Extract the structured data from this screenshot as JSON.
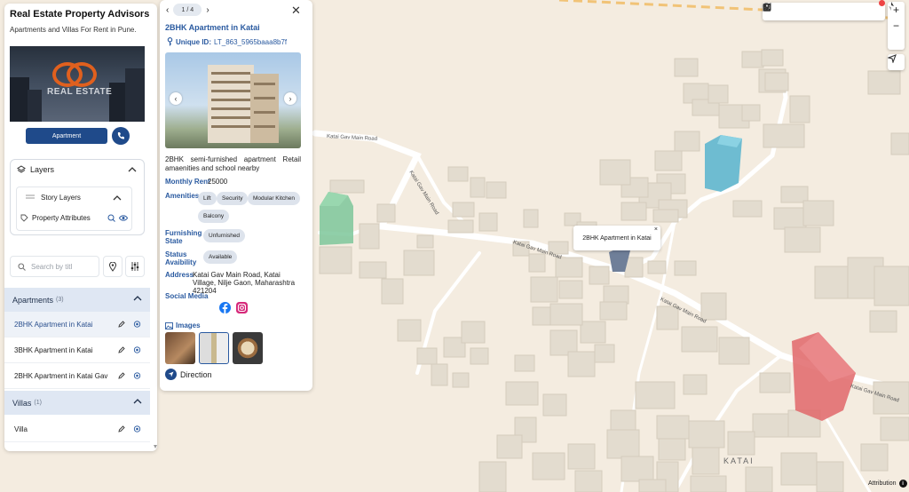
{
  "sidebar": {
    "title": "Real Estate Property Advisors",
    "subtitle": "Apartments and Villas For Rent in Pune.",
    "logo_text": "REAL ESTATE",
    "apartment_button": "Apartment",
    "layers": {
      "heading": "Layers",
      "story_layers": "Story Layers",
      "property_attributes": "Property Attributes"
    },
    "search": {
      "placeholder": "Search by titl"
    },
    "groups": [
      {
        "label": "Apartments",
        "count": "(3)",
        "items": [
          {
            "label": "2BHK Apartment in Katai",
            "active": true
          },
          {
            "label": "3BHK Apartment in Katai",
            "active": false
          },
          {
            "label": "2BHK Apartment in Katai Gav",
            "active": false
          }
        ]
      },
      {
        "label": "Villas",
        "count": "(1)",
        "items": [
          {
            "label": "Villa",
            "active": false
          }
        ]
      }
    ]
  },
  "detail": {
    "pager": "1 / 4",
    "title": "2BHK Apartment in Katai",
    "unique_id_label": "Unique ID:",
    "unique_id_value": "LT_863_5965baaa8b7f",
    "description": "2BHK semi-furnished apartment Retail amaenities and school nearby",
    "monthly_rent_label": "Monthly Rent",
    "monthly_rent_value": "25000",
    "amenities_label": "Amenities",
    "amenities": [
      "Lift",
      "Security",
      "Modular Kitchen",
      "Balcony"
    ],
    "furnishing_label_1": "Furnishing",
    "furnishing_label_2": "State",
    "furnishing_value": "Unfurnished",
    "status_label_1": "Status",
    "status_label_2": "Avaibility",
    "status_value": "Available",
    "address_label": "Address",
    "address_value": "Katai Gav Main Road, Katai Village, Nilje Gaon, Maharashtra 421204",
    "social_label": "Social Media",
    "images_label": "Images",
    "direction_label": "Direction"
  },
  "map": {
    "tooltip": "2BHK Apartment in Katai",
    "road_labels": [
      "Katai Gav Main Road",
      "Katai Gav Main Road",
      "Katai Gav Main Road",
      "Katai Gav Main Road",
      "Katai Gav Main Road"
    ],
    "place_label": "KATAI",
    "attribution": "Attribution",
    "zoom_in": "+",
    "zoom_out": "−"
  },
  "colors": {
    "accent": "#1f4a8a",
    "link": "#2a5aa0",
    "group_bg": "#dfe7f3",
    "building_green": "#7cc79a",
    "building_blue": "#5fb7cf",
    "building_red": "#e0676a"
  }
}
